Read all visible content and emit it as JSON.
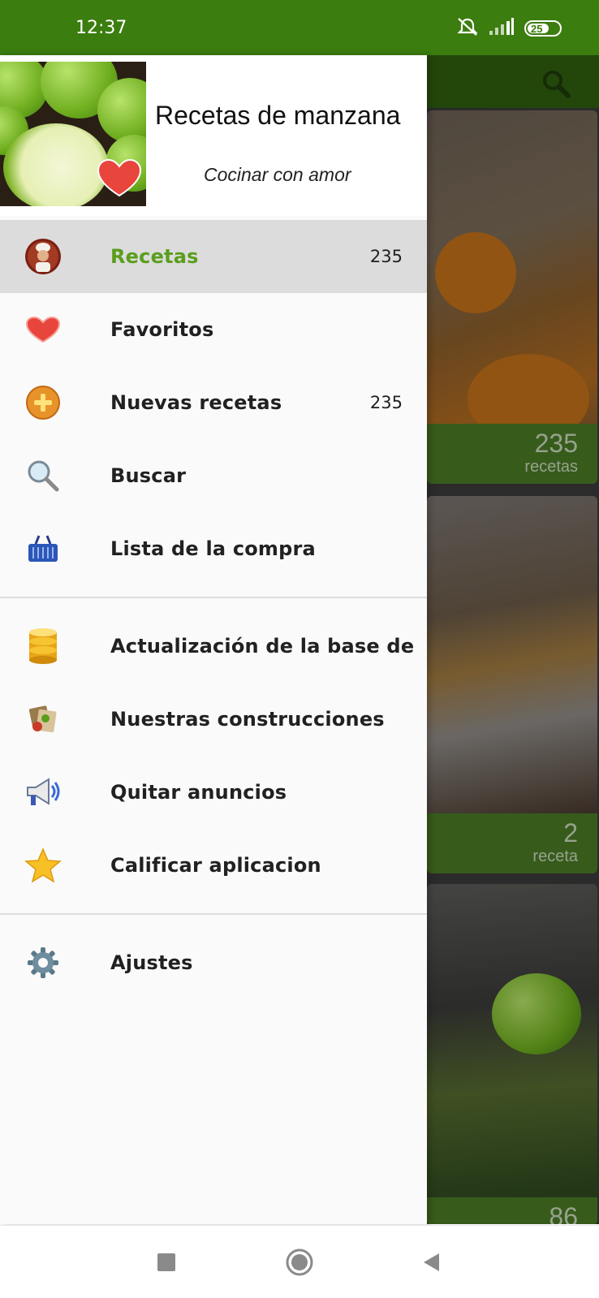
{
  "status_bar": {
    "time": "12:37",
    "battery": "25"
  },
  "drawer": {
    "header": {
      "title": "Recetas de manzana",
      "subtitle": "Cocinar con amor"
    },
    "items": [
      {
        "label": "Recetas",
        "count": "235",
        "icon": "chef-icon",
        "active": true
      },
      {
        "label": "Favoritos",
        "count": "",
        "icon": "heart-icon"
      },
      {
        "label": "Nuevas recetas",
        "count": "235",
        "icon": "plus-icon"
      },
      {
        "label": "Buscar",
        "count": "",
        "icon": "search-icon"
      },
      {
        "label": "Lista de la compra",
        "count": "",
        "icon": "basket-icon"
      },
      {
        "label": "Actualización de la base de",
        "count": "",
        "icon": "database-icon"
      },
      {
        "label": "Nuestras construcciones",
        "count": "",
        "icon": "apps-icon"
      },
      {
        "label": "Quitar anuncios",
        "count": "",
        "icon": "megaphone-icon"
      },
      {
        "label": "Calificar aplicacion",
        "count": "",
        "icon": "star-icon"
      },
      {
        "label": "Ajustes",
        "count": "",
        "icon": "gear-icon"
      }
    ]
  },
  "background_cards": [
    {
      "count": "235",
      "label": "recetas"
    },
    {
      "count": "2",
      "label": "receta"
    },
    {
      "count": "86",
      "label": ""
    }
  ],
  "colors": {
    "status_bar": "#3b7d0e",
    "accent": "#5a9e1c",
    "active_row": "#dcdcdc",
    "drawer_bg": "#fafafa"
  }
}
